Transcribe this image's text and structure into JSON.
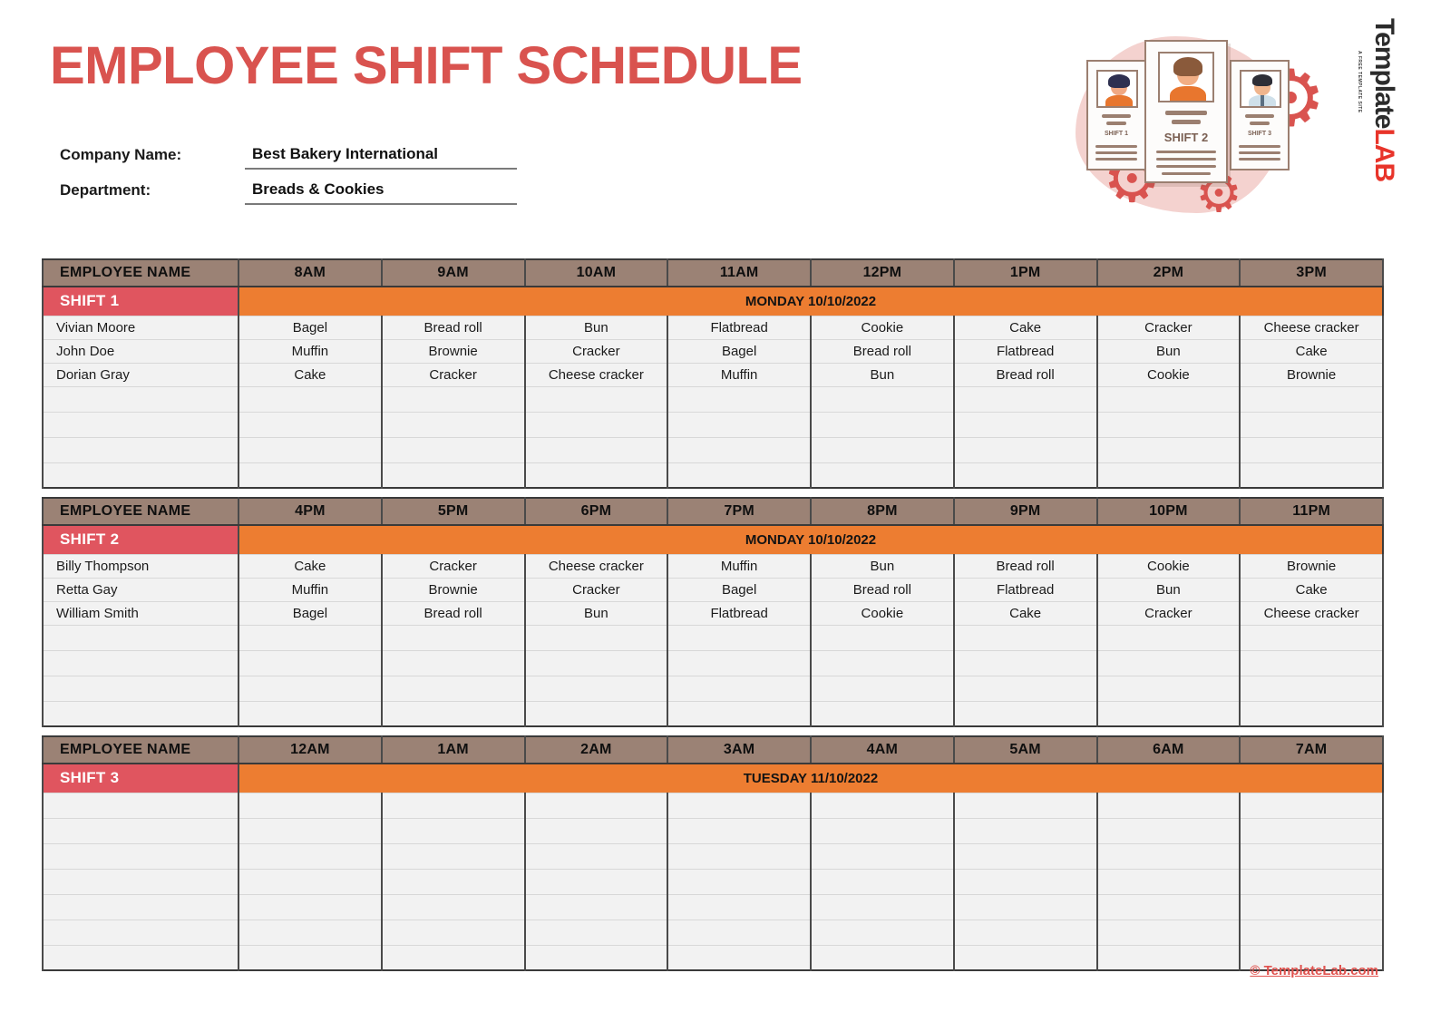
{
  "header": {
    "title": "EMPLOYEE SHIFT SCHEDULE",
    "fields": [
      {
        "label": "Company Name:",
        "value": "Best Bakery International"
      },
      {
        "label": "Department:",
        "value": "Breads & Cookies"
      }
    ]
  },
  "logo": {
    "cards": [
      {
        "caption": "SHIFT 1"
      },
      {
        "caption": "SHIFT 2"
      },
      {
        "caption": "SHIFT 3"
      }
    ],
    "brand_primary": "Template",
    "brand_accent": "LAB",
    "brand_tagline": "A FREE TEMPLATE SITE"
  },
  "colors": {
    "title_red": "#d9534f",
    "header_taupe": "#9b8275",
    "shift_red": "#e0555f",
    "date_orange": "#ed7d31",
    "row_gray": "#f2f2f2"
  },
  "tables": [
    {
      "name_header": "EMPLOYEE NAME",
      "hours": [
        "8AM",
        "9AM",
        "10AM",
        "11AM",
        "12PM",
        "1PM",
        "2PM",
        "3PM"
      ],
      "shift_label": "SHIFT 1",
      "date": "MONDAY 10/10/2022",
      "rows": [
        {
          "name": "Vivian Moore",
          "cells": [
            "Bagel",
            "Bread roll",
            "Bun",
            "Flatbread",
            "Cookie",
            "Cake",
            "Cracker",
            "Cheese cracker"
          ]
        },
        {
          "name": "John Doe",
          "cells": [
            "Muffin",
            "Brownie",
            "Cracker",
            "Bagel",
            "Bread roll",
            "Flatbread",
            "Bun",
            "Cake"
          ]
        },
        {
          "name": "Dorian Gray",
          "cells": [
            "Cake",
            "Cracker",
            "Cheese cracker",
            "Muffin",
            "Bun",
            "Bread roll",
            "Cookie",
            "Brownie"
          ]
        },
        {
          "name": "",
          "cells": [
            "",
            "",
            "",
            "",
            "",
            "",
            "",
            ""
          ]
        },
        {
          "name": "",
          "cells": [
            "",
            "",
            "",
            "",
            "",
            "",
            "",
            ""
          ]
        },
        {
          "name": "",
          "cells": [
            "",
            "",
            "",
            "",
            "",
            "",
            "",
            ""
          ]
        },
        {
          "name": "",
          "cells": [
            "",
            "",
            "",
            "",
            "",
            "",
            "",
            ""
          ]
        }
      ]
    },
    {
      "name_header": "EMPLOYEE NAME",
      "hours": [
        "4PM",
        "5PM",
        "6PM",
        "7PM",
        "8PM",
        "9PM",
        "10PM",
        "11PM"
      ],
      "shift_label": "SHIFT 2",
      "date": "MONDAY 10/10/2022",
      "rows": [
        {
          "name": "Billy Thompson",
          "cells": [
            "Cake",
            "Cracker",
            "Cheese cracker",
            "Muffin",
            "Bun",
            "Bread roll",
            "Cookie",
            "Brownie"
          ]
        },
        {
          "name": "Retta Gay",
          "cells": [
            "Muffin",
            "Brownie",
            "Cracker",
            "Bagel",
            "Bread roll",
            "Flatbread",
            "Bun",
            "Cake"
          ]
        },
        {
          "name": "William Smith",
          "cells": [
            "Bagel",
            "Bread roll",
            "Bun",
            "Flatbread",
            "Cookie",
            "Cake",
            "Cracker",
            "Cheese cracker"
          ]
        },
        {
          "name": "",
          "cells": [
            "",
            "",
            "",
            "",
            "",
            "",
            "",
            ""
          ]
        },
        {
          "name": "",
          "cells": [
            "",
            "",
            "",
            "",
            "",
            "",
            "",
            ""
          ]
        },
        {
          "name": "",
          "cells": [
            "",
            "",
            "",
            "",
            "",
            "",
            "",
            ""
          ]
        },
        {
          "name": "",
          "cells": [
            "",
            "",
            "",
            "",
            "",
            "",
            "",
            ""
          ]
        }
      ]
    },
    {
      "name_header": "EMPLOYEE NAME",
      "hours": [
        "12AM",
        "1AM",
        "2AM",
        "3AM",
        "4AM",
        "5AM",
        "6AM",
        "7AM"
      ],
      "shift_label": "SHIFT 3",
      "date": "TUESDAY 11/10/2022",
      "rows": [
        {
          "name": "",
          "cells": [
            "",
            "",
            "",
            "",
            "",
            "",
            "",
            ""
          ]
        },
        {
          "name": "",
          "cells": [
            "",
            "",
            "",
            "",
            "",
            "",
            "",
            ""
          ]
        },
        {
          "name": "",
          "cells": [
            "",
            "",
            "",
            "",
            "",
            "",
            "",
            ""
          ]
        },
        {
          "name": "",
          "cells": [
            "",
            "",
            "",
            "",
            "",
            "",
            "",
            ""
          ]
        },
        {
          "name": "",
          "cells": [
            "",
            "",
            "",
            "",
            "",
            "",
            "",
            ""
          ]
        },
        {
          "name": "",
          "cells": [
            "",
            "",
            "",
            "",
            "",
            "",
            "",
            ""
          ]
        },
        {
          "name": "",
          "cells": [
            "",
            "",
            "",
            "",
            "",
            "",
            "",
            ""
          ]
        }
      ]
    }
  ],
  "footer": {
    "copyright": "© TemplateLab.com"
  }
}
